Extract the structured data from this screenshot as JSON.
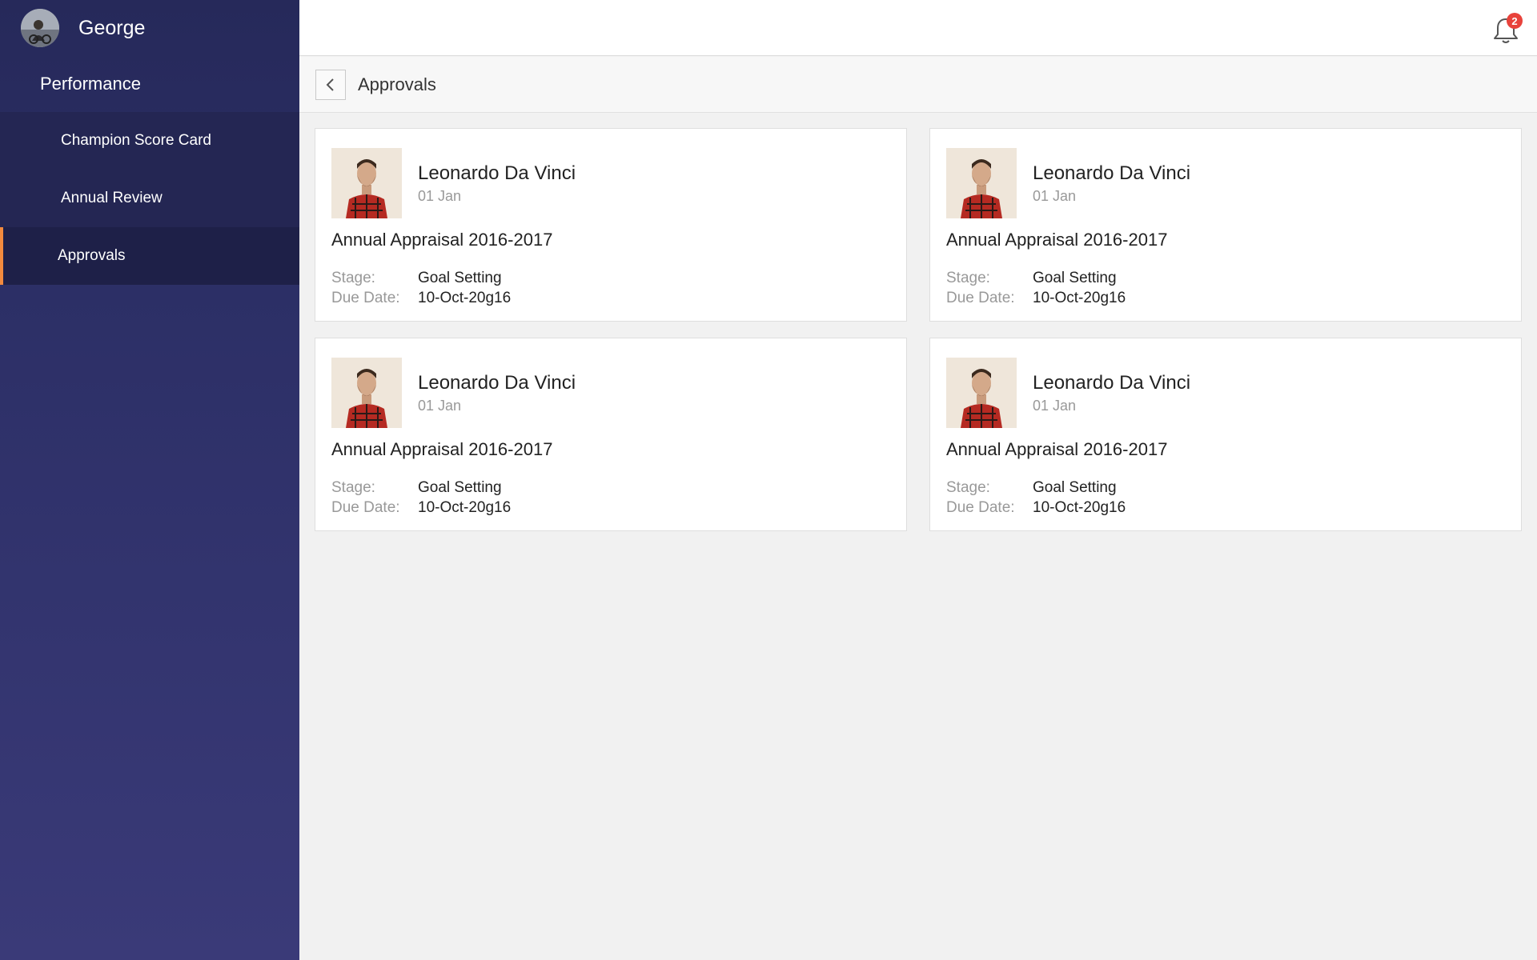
{
  "sidebar": {
    "user_name": "George",
    "section": "Performance",
    "items": [
      {
        "label": "Champion Score Card"
      },
      {
        "label": "Annual Review"
      },
      {
        "label": "Approvals"
      }
    ]
  },
  "topbar": {
    "notification_count": "2",
    "icons": {
      "bell": "bell-icon"
    }
  },
  "page": {
    "title": "Approvals"
  },
  "colors": {
    "accent": "#f28a3e",
    "sidebar": "#2c2f66",
    "badge": "#e8423b"
  },
  "cards": [
    {
      "name": "Leonardo Da Vinci",
      "date": "01 Jan",
      "title": "Annual Appraisal 2016-2017",
      "stage_label": "Stage:",
      "stage": "Goal Setting",
      "due_label": "Due Date:",
      "due": "10-Oct-20g16"
    },
    {
      "name": "Leonardo Da Vinci",
      "date": "01 Jan",
      "title": "Annual Appraisal 2016-2017",
      "stage_label": "Stage:",
      "stage": "Goal Setting",
      "due_label": "Due Date:",
      "due": "10-Oct-20g16"
    },
    {
      "name": "Leonardo Da Vinci",
      "date": "01 Jan",
      "title": "Annual Appraisal 2016-2017",
      "stage_label": "Stage:",
      "stage": "Goal Setting",
      "due_label": "Due Date:",
      "due": "10-Oct-20g16"
    },
    {
      "name": "Leonardo Da Vinci",
      "date": "01 Jan",
      "title": "Annual Appraisal 2016-2017",
      "stage_label": "Stage:",
      "stage": "Goal Setting",
      "due_label": "Due Date:",
      "due": "10-Oct-20g16"
    }
  ]
}
